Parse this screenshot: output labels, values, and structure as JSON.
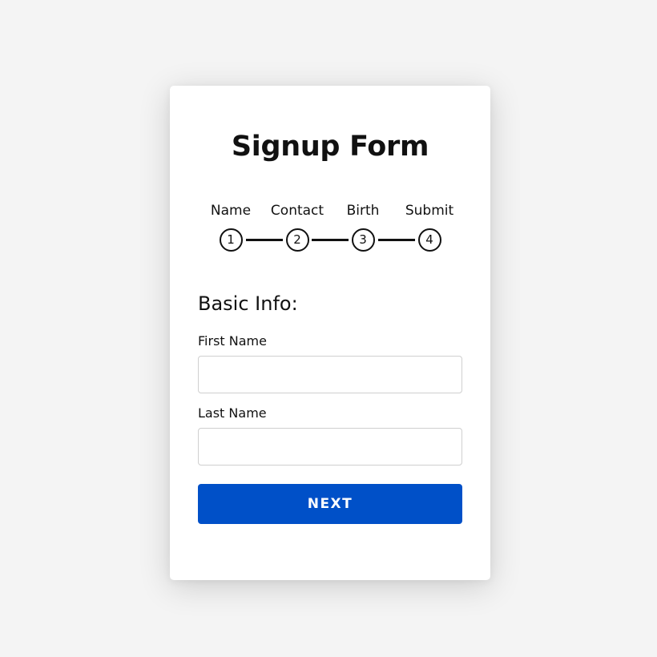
{
  "form": {
    "title": "Signup Form",
    "steps": [
      {
        "label": "Name",
        "number": "1"
      },
      {
        "label": "Contact",
        "number": "2"
      },
      {
        "label": "Birth",
        "number": "3"
      },
      {
        "label": "Submit",
        "number": "4"
      }
    ],
    "section_heading": "Basic Info:",
    "fields": {
      "first_name": {
        "label": "First Name",
        "value": "",
        "placeholder": ""
      },
      "last_name": {
        "label": "Last Name",
        "value": "",
        "placeholder": ""
      }
    },
    "next_label": "NEXT"
  },
  "colors": {
    "background": "#f4f4f4",
    "card": "#ffffff",
    "accent": "#0050c8",
    "text": "#111111"
  }
}
